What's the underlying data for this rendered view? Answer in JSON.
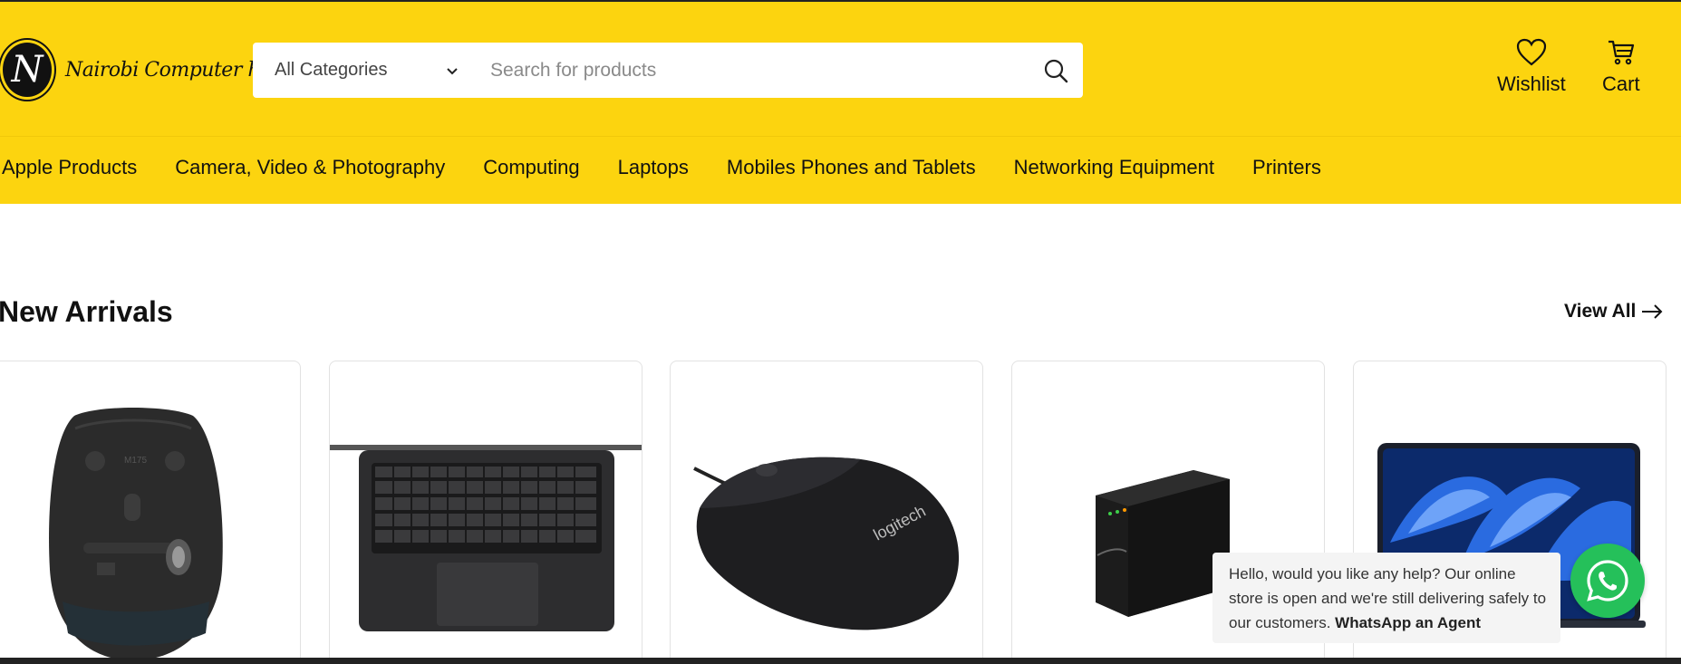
{
  "brand": {
    "logo_letter": "N",
    "name": "Nairobi Computer house"
  },
  "search": {
    "category_label": "All Categories",
    "placeholder": "Search for products",
    "value": ""
  },
  "header_actions": {
    "wishlist_label": "Wishlist",
    "cart_label": "Cart"
  },
  "nav": {
    "items": [
      {
        "label": "Apple Products"
      },
      {
        "label": "Camera, Video & Photography"
      },
      {
        "label": "Computing"
      },
      {
        "label": "Laptops"
      },
      {
        "label": "Mobiles Phones and Tablets"
      },
      {
        "label": "Networking Equipment"
      },
      {
        "label": "Printers"
      }
    ]
  },
  "new_arrivals": {
    "title": "New Arrivals",
    "view_all_label": "View All",
    "products": [
      {
        "image": "wireless-mouse-underside"
      },
      {
        "image": "laptop-keyboard-top-view"
      },
      {
        "image": "logitech-wired-mouse",
        "logo_text": "logitech"
      },
      {
        "image": "ups-power-backup"
      },
      {
        "image": "macbook-air-blue-wallpaper"
      }
    ]
  },
  "chat": {
    "message": "Hello, would you like any help? Our online store is open and we're still delivering safely to our customers.",
    "cta_label": "WhatsApp an Agent"
  },
  "colors": {
    "header_bg": "#fcd40f",
    "whatsapp_green": "#25c05a",
    "text": "#111111"
  }
}
